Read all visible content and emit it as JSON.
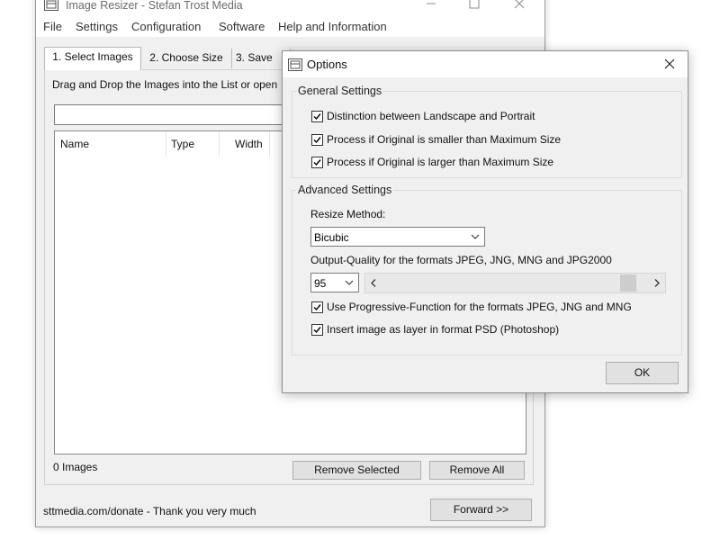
{
  "main_window": {
    "title": "Image Resizer - Stefan Trost Media",
    "menu": [
      "File",
      "Settings",
      "Configuration",
      "Software",
      "Help and Information"
    ],
    "tabs": [
      "1. Select Images",
      "2. Choose Size",
      "3. Save"
    ],
    "drag_label": "Drag and Drop the Images into the List or open",
    "columns": [
      "Name",
      "Type",
      "Width"
    ],
    "image_count": "0 Images",
    "remove_selected_label": "Remove Selected",
    "remove_all_label": "Remove All",
    "donate_text": "sttmedia.com/donate - Thank you very much",
    "forward_label": "Forward >>"
  },
  "options_dialog": {
    "title": "Options",
    "general": {
      "label": "General Settings",
      "items": [
        {
          "label": "Distinction between Landscape and Portrait",
          "checked": true
        },
        {
          "label": "Process if Original is smaller than Maximum Size",
          "checked": true
        },
        {
          "label": "Process if Original is larger than Maximum Size",
          "checked": true
        }
      ]
    },
    "advanced": {
      "label": "Advanced Settings",
      "resize_method_label": "Resize Method:",
      "resize_method_value": "Bicubic",
      "quality_label": "Output-Quality for the formats JPEG, JNG, MNG and JPG2000",
      "quality_value": "95",
      "quality_level": 0.95,
      "items": [
        {
          "label": "Use Progressive-Function for the formats JPEG, JNG and MNG",
          "checked": true
        },
        {
          "label": "Insert image as layer in format PSD (Photoshop)",
          "checked": true
        }
      ]
    },
    "ok_label": "OK"
  },
  "icons": {
    "app": "app-window-icon",
    "minimize": "minimize-icon",
    "maximize": "maximize-icon",
    "close": "close-icon",
    "dropdown": "chevron-down-icon",
    "scroll_left": "chevron-left-icon",
    "scroll_right": "chevron-right-icon",
    "check": "checkmark-icon"
  }
}
